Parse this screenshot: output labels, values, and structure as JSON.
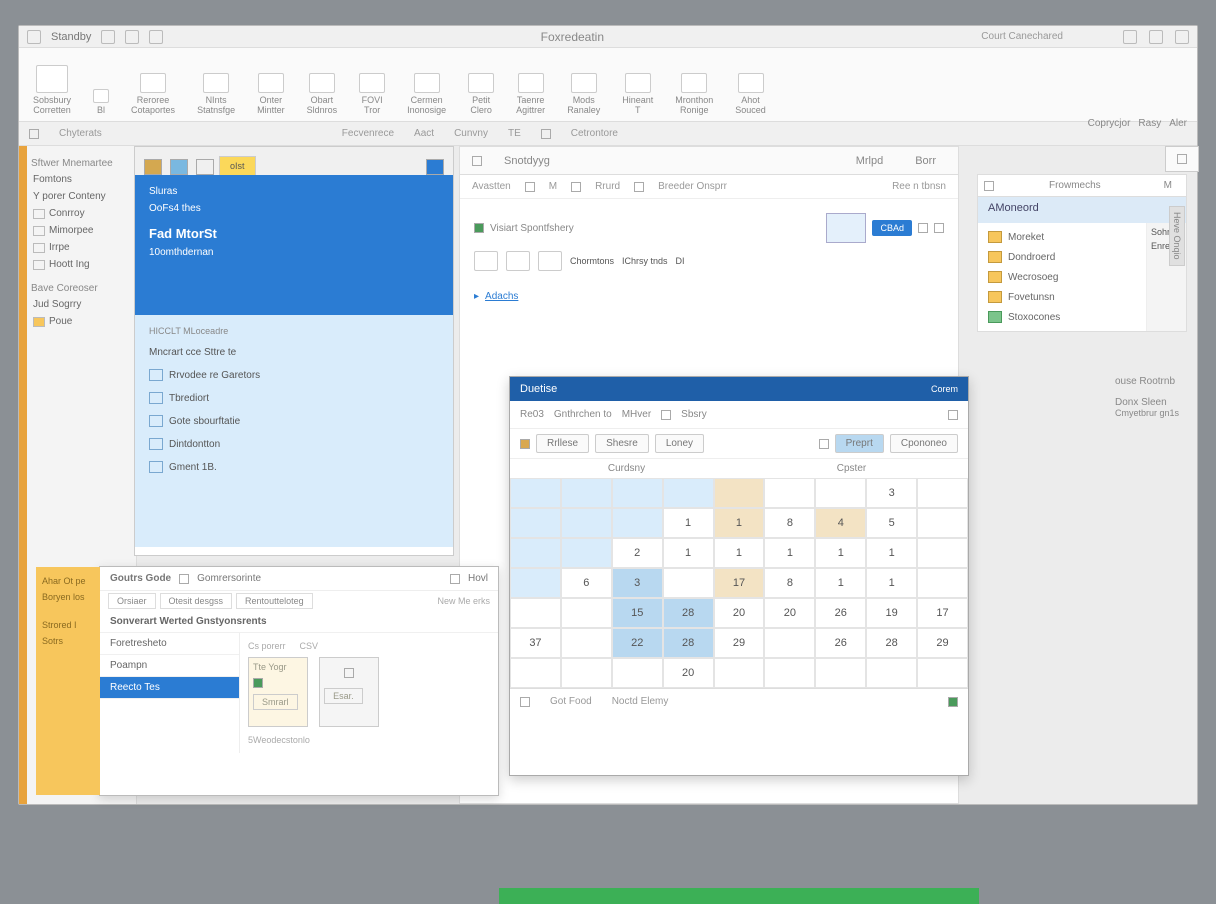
{
  "titlebar": {
    "left": [
      "",
      "Standby",
      "",
      "",
      ""
    ],
    "title": "Foxredeatin",
    "right_group": "Court Canechared"
  },
  "ribbon": [
    {
      "label": "Sobsbury",
      "sub": "Corretten"
    },
    {
      "label": "Bl"
    },
    {
      "label": "Reroree",
      "sub": "Cotaportes"
    },
    {
      "label": "NInts",
      "sub": "Statnsfge"
    },
    {
      "label": "Onter",
      "sub": "Mintter"
    },
    {
      "label": "Obart",
      "sub": "Sldnros"
    },
    {
      "label": "FOVI",
      "sub": "Tror"
    },
    {
      "label": "Cermen",
      "sub": "Inonosige"
    },
    {
      "label": "Petit",
      "sub": "Clero"
    },
    {
      "label": "Taenre",
      "sub": "Agittrer"
    },
    {
      "label": "Mods",
      "sub": "Ranaley"
    },
    {
      "label": "Hineant",
      "sub": "T"
    },
    {
      "label": "Mronthon",
      "sub": "Ronige"
    },
    {
      "label": "Ahot",
      "sub": "Souced"
    }
  ],
  "subbar": {
    "items": [
      "Chyterats",
      "Fecvenrece",
      "Aact",
      "Cunvny",
      "TE",
      "Cetrontore"
    ]
  },
  "leftside": {
    "section1": "Sftwer Mnemartee",
    "items1": [
      "Fomtons",
      "Y porer Conteny"
    ],
    "items2": [
      "Conrroy",
      "Mimorpee",
      "Irrpe",
      "Hoott Ing"
    ],
    "section2": "Bave Coreoser",
    "item3": "Jud Sogrry",
    "item4": "Poue"
  },
  "bluepanel": {
    "tabs": [
      "",
      "",
      "oIst"
    ],
    "blue": {
      "t1": "Sluras",
      "t2": "OoFs4 thes",
      "head": "Fad MtorSt",
      "t3": "10omthdernan"
    },
    "list_header": "HICCLT MLoceadre",
    "list": [
      "Mncrart cce Sttre te",
      "Rrvodee re Garetors",
      "Tbrediort",
      "Gote sbourftatie",
      "Dintdontton",
      "Gment 1B."
    ]
  },
  "centerpane": {
    "tabs": [
      "Snotdyyg",
      "Mrlpd",
      "Borr"
    ],
    "right_tabs": [
      "Coprycjor",
      "Rasy",
      "Aler"
    ],
    "subbar": [
      "Avastten",
      "M",
      "Rrurd",
      "Breeder Onsprr"
    ],
    "subbar_right": "Ree n tbnsn",
    "caption": "Visiart  Spontfshery",
    "btn": "CBAd",
    "row_items": [
      "Chormtons",
      "IChrsy tnds",
      "DI"
    ],
    "anchor": "Adachs"
  },
  "rightpanel": {
    "top_tabs": [
      "",
      "Frowmechs",
      "M"
    ],
    "title": "AMoneord",
    "side_tab": "Sohred",
    "side_tab2": "Enreg",
    "list": [
      {
        "icon": "y",
        "label": "Moreket"
      },
      {
        "icon": "y",
        "label": "Dondroerd"
      },
      {
        "icon": "y",
        "label": "Wecrosoeg"
      },
      {
        "icon": "y",
        "label": "Fovetunsn"
      },
      {
        "icon": "g",
        "label": "Stoxocones"
      }
    ],
    "below1": "ouse Rootrnb",
    "below2": "Donx Sleen",
    "below3": "Cmyetbrur gn1s"
  },
  "caldialog": {
    "title": "Duetise",
    "close": "Corem",
    "tool_items": [
      "Re03",
      "Gnthrchen to",
      "MHver",
      "Sbsry"
    ],
    "tool2": [
      "Rrllese",
      "Shesre",
      "Loney"
    ],
    "tool2_right": [
      "Preprt",
      "Cpononeo"
    ],
    "day_icon": "",
    "hdr": [
      "Curdsny",
      "Cpster"
    ],
    "rows": [
      [
        "",
        "",
        "",
        "",
        "",
        "3",
        ""
      ],
      [
        "",
        "",
        "",
        "1",
        "1",
        "8",
        "4",
        "5"
      ],
      [
        "",
        "",
        "2",
        "1",
        "1",
        "1",
        "1",
        "1"
      ],
      [
        "",
        "6",
        "3",
        "",
        "17",
        "8",
        "1",
        "1"
      ],
      [
        "",
        "",
        "15",
        "28",
        "20",
        "20",
        "26",
        "19",
        "17"
      ],
      [
        "37",
        "",
        "22",
        "28",
        "29",
        "",
        "26",
        "28",
        "29"
      ],
      [
        "",
        "",
        "",
        "20",
        "",
        "",
        "",
        "",
        ""
      ]
    ],
    "foot": [
      "Got Food",
      "Noctd Elemy"
    ]
  },
  "propspanel": {
    "orange": [
      "Ahar Ot pe",
      "Boryen los",
      "Strored I",
      "Sotrs"
    ],
    "hdr_left": "Goutrs Gode",
    "hdr_mid": "Gomrersorinte",
    "hdr_right": "Hovl",
    "tabs": [
      "Orsiaer",
      "Otesit desgss",
      "Rentoutteloteg"
    ],
    "sub": "New Me erks",
    "row": "Sonverart Werted Gnstyonsrents",
    "left_items": [
      "Foretresheto",
      "Poampn",
      "Reecto Tes"
    ],
    "right_items": [
      "Cs porerr",
      "CSV"
    ],
    "card1": "Tte    Yogr",
    "card1_btn": "Smrarl",
    "card2_btn": "Esar.",
    "foot": "5Weodecstonlo"
  },
  "sidetabs": [
    "Heve Onqio"
  ]
}
